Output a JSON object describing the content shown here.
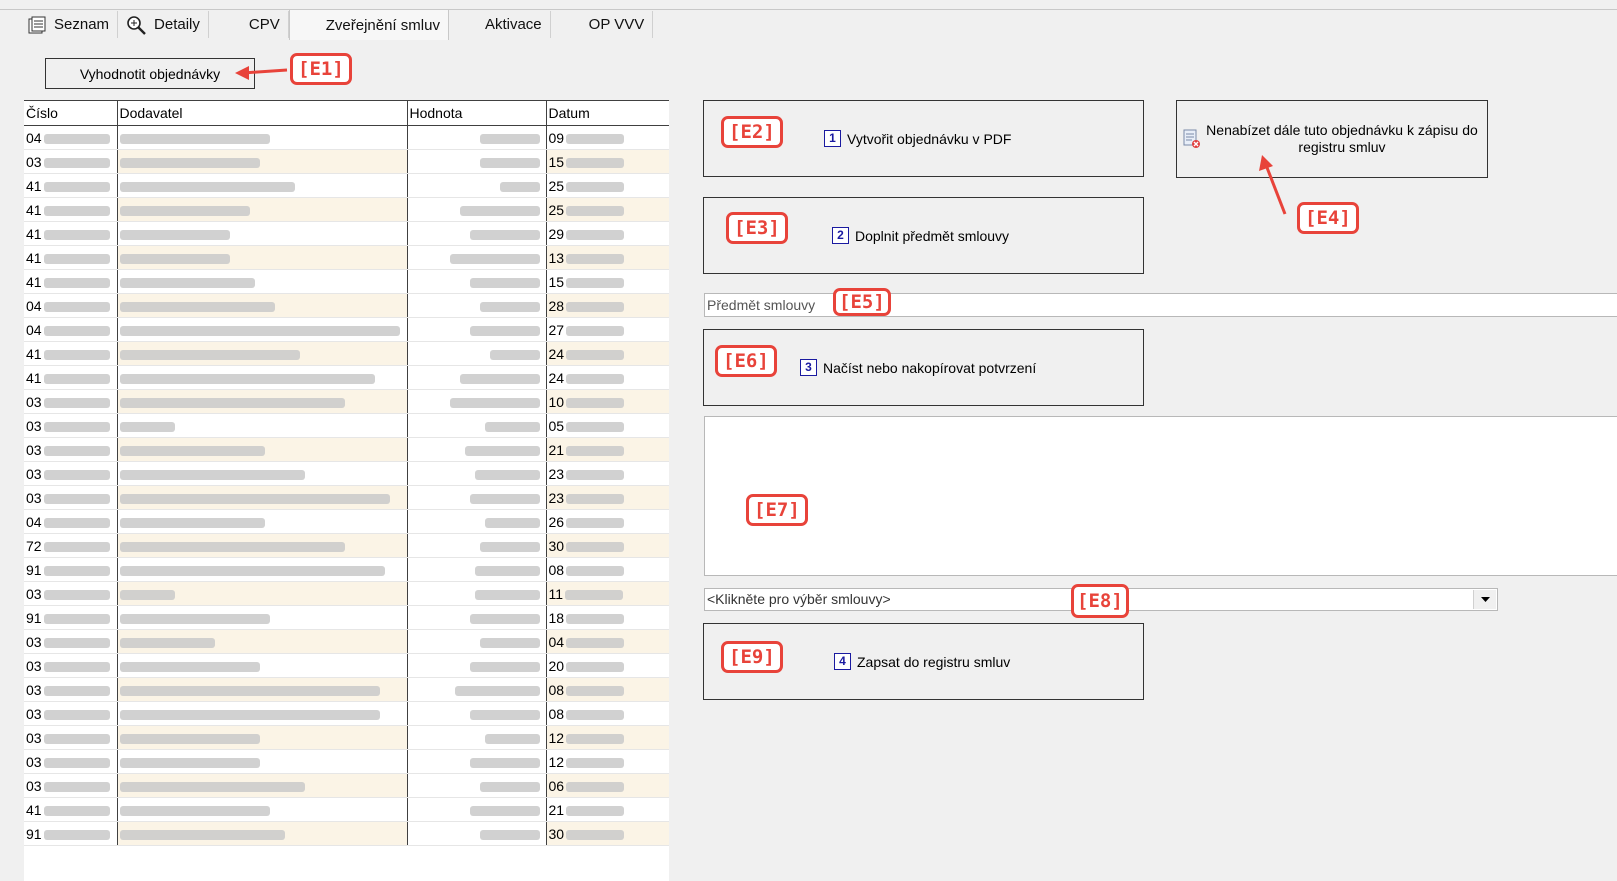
{
  "tabs": [
    {
      "label": "Seznam",
      "icon": "list-icon"
    },
    {
      "label": "Detaily",
      "icon": "magnifier-icon"
    },
    {
      "label": "CPV",
      "icon": ""
    },
    {
      "label": "Zveřejnění smluv",
      "icon": ""
    },
    {
      "label": "Aktivace",
      "icon": ""
    },
    {
      "label": "OP VVV",
      "icon": ""
    }
  ],
  "evaluate_button": "Vyhodnotit objednávky",
  "grid": {
    "columns": [
      "Číslo",
      "Dodavatel",
      "Hodnota",
      "Datum"
    ],
    "rows": [
      {
        "cislo": "04",
        "datum": "09"
      },
      {
        "cislo": "03",
        "datum": "15"
      },
      {
        "cislo": "41",
        "datum": "25"
      },
      {
        "cislo": "41",
        "datum": "25"
      },
      {
        "cislo": "41",
        "datum": "29"
      },
      {
        "cislo": "41",
        "datum": "13"
      },
      {
        "cislo": "41",
        "datum": "15"
      },
      {
        "cislo": "04",
        "datum": "28"
      },
      {
        "cislo": "04",
        "datum": "27"
      },
      {
        "cislo": "41",
        "datum": "24"
      },
      {
        "cislo": "41",
        "datum": "24"
      },
      {
        "cislo": "03",
        "datum": "10"
      },
      {
        "cislo": "03",
        "datum": "05"
      },
      {
        "cislo": "03",
        "datum": "21"
      },
      {
        "cislo": "03",
        "datum": "23"
      },
      {
        "cislo": "03",
        "datum": "23"
      },
      {
        "cislo": "04",
        "datum": "26"
      },
      {
        "cislo": "72",
        "datum": "30"
      },
      {
        "cislo": "91",
        "datum": "08"
      },
      {
        "cislo": "03",
        "datum": "11"
      },
      {
        "cislo": "91",
        "datum": "18"
      },
      {
        "cislo": "03",
        "datum": "04"
      },
      {
        "cislo": "03",
        "datum": "20"
      },
      {
        "cislo": "03",
        "datum": "08"
      },
      {
        "cislo": "03",
        "datum": "08"
      },
      {
        "cislo": "03",
        "datum": "12"
      },
      {
        "cislo": "03",
        "datum": "12"
      },
      {
        "cislo": "03",
        "datum": "06"
      },
      {
        "cislo": "41",
        "datum": "21"
      },
      {
        "cislo": "91",
        "datum": "30"
      }
    ]
  },
  "actions": {
    "create_pdf": {
      "num": "1",
      "label": "Vytvořit objednávku v PDF"
    },
    "fill_subject": {
      "num": "2",
      "label": "Doplnit předmět smlouvy"
    },
    "load_confirmation": {
      "num": "3",
      "label": "Načíst nebo nakopírovat potvrzení"
    },
    "write_registry": {
      "num": "4",
      "label": "Zapsat do registru smluv"
    }
  },
  "dont_offer": "Nenabízet dále tuto objednávku k zápisu do registru smluv",
  "subject_placeholder": "Předmět smlouvy",
  "contract_select": "<Klikněte pro výběr smlouvy>",
  "markers": [
    "[E1]",
    "[E2]",
    "[E3]",
    "[E4]",
    "[E5]",
    "[E6]",
    "[E7]",
    "[E8]",
    "[E9]"
  ],
  "colors": {
    "marker": "#e8433a",
    "num_badge": "#1a1aa0",
    "row_alt": "#fbf4e6"
  }
}
